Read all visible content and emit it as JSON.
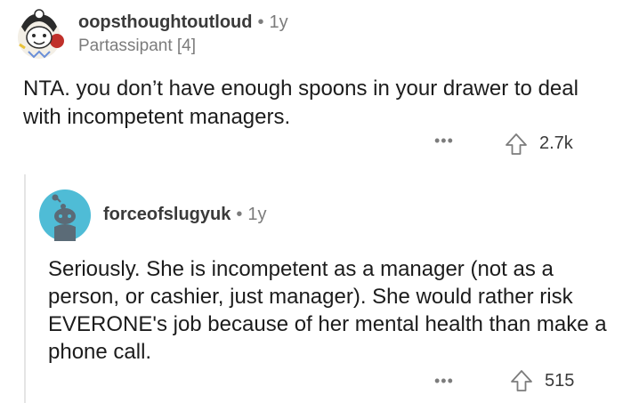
{
  "comment": {
    "avatar_icon": "snoo-avatar-icon",
    "username": "oopsthoughtoutloud",
    "separator": "•",
    "age": "1y",
    "flair": "Partassipant [4]",
    "body": "NTA. you don’t have enough spoons in your drawer to deal with incompetent managers.",
    "more_label": "•••",
    "upvote_icon": "upvote-arrow-icon",
    "score": "2.7k"
  },
  "reply": {
    "avatar_icon": "snoo-avatar-icon",
    "avatar_color": "#4fbcd6",
    "username": "forceofslugyuk",
    "separator": "•",
    "age": "1y",
    "body": "Seriously. She is incompetent as a manager (not as a person, or cashier, just manager). She would rather risk EVERONE's job because of her mental health than make a phone call.",
    "more_label": "•••",
    "upvote_icon": "upvote-arrow-icon",
    "score": "515"
  }
}
